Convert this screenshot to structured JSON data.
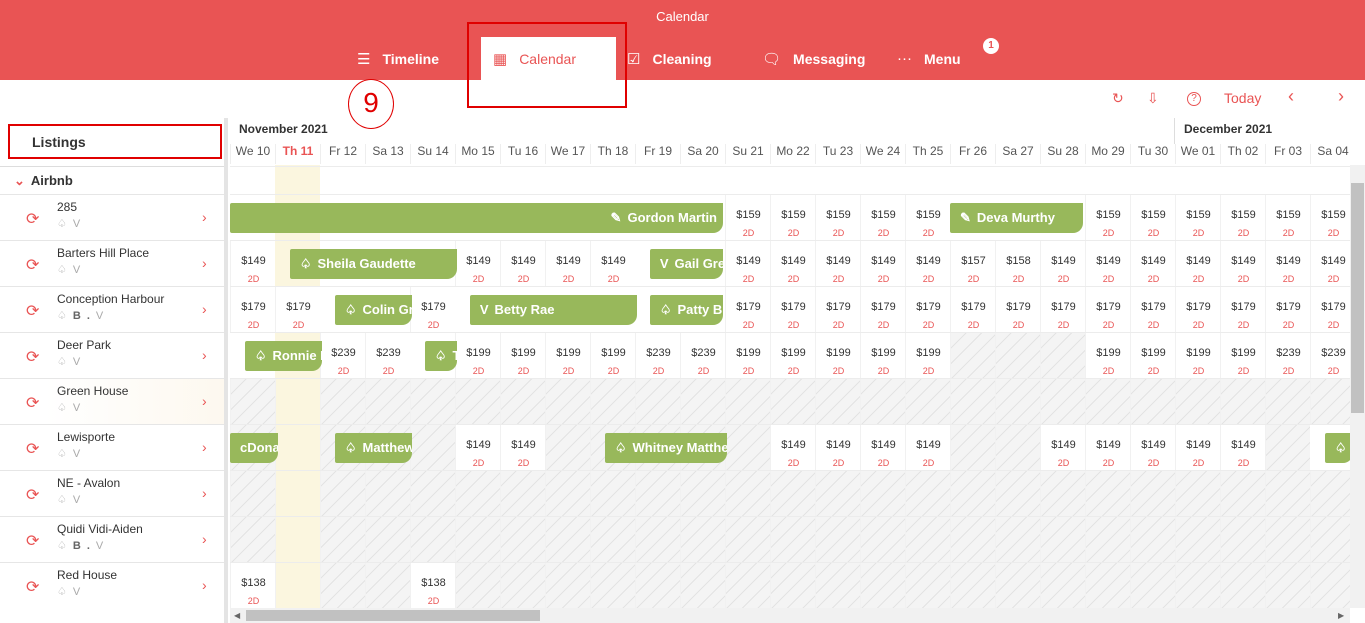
{
  "app": {
    "title": "Calendar"
  },
  "nav": {
    "items": [
      {
        "label": "Timeline",
        "icon": "list-icon",
        "glyph": "☰"
      },
      {
        "label": "Calendar",
        "icon": "calendar-icon",
        "glyph": "▦"
      },
      {
        "label": "Cleaning",
        "icon": "checklist-icon",
        "glyph": "☑"
      },
      {
        "label": "Messaging",
        "icon": "chat-icon",
        "glyph": "🗨"
      },
      {
        "label": "Menu",
        "icon": "more-icon",
        "glyph": "···"
      }
    ],
    "menu_badge": "1"
  },
  "annotation": {
    "step": "9"
  },
  "toolbar": {
    "today_label": "Today",
    "refresh_glyph": "↻",
    "export_glyph": "⇩",
    "help_glyph": "?",
    "prev_glyph": "‹",
    "next_glyph": "›"
  },
  "sidebar": {
    "header": "Listings",
    "group": "Airbnb",
    "listings": [
      {
        "name": "285",
        "channels": "airbnb vrbo"
      },
      {
        "name": "Barters Hill Place",
        "channels": "airbnb vrbo"
      },
      {
        "name": "Conception Harbour",
        "channels": "airbnb booking vrbo"
      },
      {
        "name": "Deer Park",
        "channels": "airbnb vrbo"
      },
      {
        "name": "Green House",
        "channels": "airbnb vrbo"
      },
      {
        "name": "Lewisporte",
        "channels": "airbnb vrbo"
      },
      {
        "name": "NE - Avalon",
        "channels": "airbnb vrbo"
      },
      {
        "name": "Quidi Vidi-Aiden",
        "channels": "airbnb booking vrbo"
      },
      {
        "name": "Red House",
        "channels": "airbnb vrbo"
      }
    ]
  },
  "calendar": {
    "months": [
      {
        "label": "November 2021"
      },
      {
        "label": "December 2021"
      }
    ],
    "days": [
      "We 10",
      "Th 11",
      "Fr 12",
      "Sa 13",
      "Su 14",
      "Mo 15",
      "Tu 16",
      "We 17",
      "Th 18",
      "Fr 19",
      "Sa 20",
      "Su 21",
      "Mo 22",
      "Tu 23",
      "We 24",
      "Th 25",
      "Fr 26",
      "Sa 27",
      "Su 28",
      "Mo 29",
      "Tu 30",
      "We 01",
      "Th 02",
      "Fr 03",
      "Sa 04"
    ],
    "today_index": 1,
    "min_nights": "2D",
    "rows": [
      {
        "cells": [
          null,
          null,
          null,
          null,
          null,
          null,
          null,
          null,
          null,
          null,
          null,
          "$159",
          "$159",
          "$159",
          "$159",
          "$159",
          null,
          null,
          null,
          "$159",
          "$159",
          "$159",
          "$159",
          "$159",
          "$159"
        ],
        "blocked": [],
        "bookings": [
          {
            "guest": "Gordon Martin",
            "start": 0,
            "end": 11,
            "icon": "reservation-icon",
            "glyph": "✎",
            "align": "right"
          },
          {
            "guest": "Deva Murthy",
            "start": 16,
            "end": 19,
            "icon": "reservation-icon",
            "glyph": "✎"
          }
        ]
      },
      {
        "cells": [
          "$149",
          null,
          null,
          null,
          null,
          "$149",
          "$149",
          "$149",
          "$149",
          null,
          null,
          "$149",
          "$149",
          "$149",
          "$149",
          "$149",
          "$157",
          "$158",
          "$149",
          "$149",
          "$149",
          "$149",
          "$149",
          "$149",
          "$149"
        ],
        "blocked": [],
        "bookings": [
          {
            "guest": "Sheila Gaudette",
            "start": 1.33,
            "end": 5.1,
            "icon": "airbnb-icon",
            "glyph": "♤"
          },
          {
            "guest": "Gail Greene",
            "start": 9.33,
            "end": 11,
            "icon": "vrbo-icon",
            "glyph": "V"
          }
        ]
      },
      {
        "cells": [
          "$179",
          "$179",
          null,
          null,
          "$179",
          null,
          null,
          null,
          null,
          null,
          null,
          "$179",
          "$179",
          "$179",
          "$179",
          "$179",
          "$179",
          "$179",
          "$179",
          "$179",
          "$179",
          "$179",
          "$179",
          "$179",
          "$179"
        ],
        "blocked": [],
        "bookings": [
          {
            "guest": "Colin Green",
            "start": 2.33,
            "end": 4.1,
            "icon": "airbnb-icon",
            "glyph": "♤"
          },
          {
            "guest": "Betty Rae",
            "start": 5.33,
            "end": 9.1,
            "icon": "vrbo-icon",
            "glyph": "V"
          },
          {
            "guest": "Patty Brown",
            "start": 9.33,
            "end": 11,
            "icon": "airbnb-icon",
            "glyph": "♤"
          }
        ]
      },
      {
        "cells": [
          null,
          null,
          "$239",
          "$239",
          null,
          "$199",
          "$199",
          "$199",
          "$199",
          "$239",
          "$239",
          "$199",
          "$199",
          "$199",
          "$199",
          "$199",
          null,
          null,
          null,
          "$199",
          "$199",
          "$199",
          "$199",
          "$239",
          "$239"
        ],
        "blocked": [
          16,
          17,
          18
        ],
        "bookings": [
          {
            "guest": "Ronnie Burke",
            "start": 0.33,
            "end": 2.1,
            "icon": "airbnb-icon",
            "glyph": "♤"
          },
          {
            "guest": "Tina",
            "start": 4.33,
            "end": 5.1,
            "icon": "airbnb-icon",
            "glyph": "♤"
          }
        ]
      },
      {
        "cells": [
          null,
          null,
          null,
          null,
          null,
          null,
          null,
          null,
          null,
          null,
          null,
          null,
          null,
          null,
          null,
          null,
          null,
          null,
          null,
          null,
          null,
          null,
          null,
          null,
          null
        ],
        "blocked": "all",
        "bookings": []
      },
      {
        "cells": [
          null,
          null,
          null,
          null,
          null,
          "$149",
          "$149",
          null,
          null,
          null,
          null,
          null,
          "$149",
          "$149",
          "$149",
          "$149",
          null,
          null,
          "$149",
          "$149",
          "$149",
          "$149",
          "$149",
          null,
          null
        ],
        "blocked": [
          0,
          1,
          2,
          3,
          4,
          7,
          8,
          9,
          10,
          11,
          16,
          17,
          23
        ],
        "bookings": [
          {
            "guest": "cDonald",
            "start": 0,
            "end": 1.1,
            "icon": "none",
            "glyph": ""
          },
          {
            "guest": "Matthew",
            "start": 2.33,
            "end": 4.1,
            "icon": "airbnb-icon",
            "glyph": "♤"
          },
          {
            "guest": "Whitney Matthews",
            "start": 8.33,
            "end": 11.1,
            "icon": "airbnb-icon",
            "glyph": "♤"
          },
          {
            "guest": "",
            "start": 24.33,
            "end": 25,
            "icon": "airbnb-icon",
            "glyph": "♤"
          }
        ]
      },
      {
        "cells": [
          null,
          null,
          null,
          null,
          null,
          null,
          null,
          null,
          null,
          null,
          null,
          null,
          null,
          null,
          null,
          null,
          null,
          null,
          null,
          null,
          null,
          null,
          null,
          null,
          null
        ],
        "blocked": "all",
        "bookings": []
      },
      {
        "cells": [
          null,
          null,
          null,
          null,
          null,
          null,
          null,
          null,
          null,
          null,
          null,
          null,
          null,
          null,
          null,
          null,
          null,
          null,
          null,
          null,
          null,
          null,
          null,
          null,
          null
        ],
        "blocked": "all",
        "bookings": []
      },
      {
        "cells": [
          "$138",
          null,
          null,
          null,
          "$138",
          null,
          null,
          null,
          null,
          null,
          null,
          null,
          null,
          null,
          null,
          null,
          null,
          null,
          null,
          null,
          null,
          null,
          null,
          null,
          null
        ],
        "blocked": [
          1,
          2,
          3,
          5,
          6,
          7,
          8,
          9,
          10,
          11,
          12,
          13,
          14,
          15,
          16,
          17,
          18,
          19,
          20,
          21,
          22,
          23,
          24
        ],
        "bookings": []
      }
    ]
  },
  "colors": {
    "brand": "#e95454",
    "booking": "#98b85b",
    "today_col": "#fbf6df",
    "annotation": "#e00000"
  }
}
